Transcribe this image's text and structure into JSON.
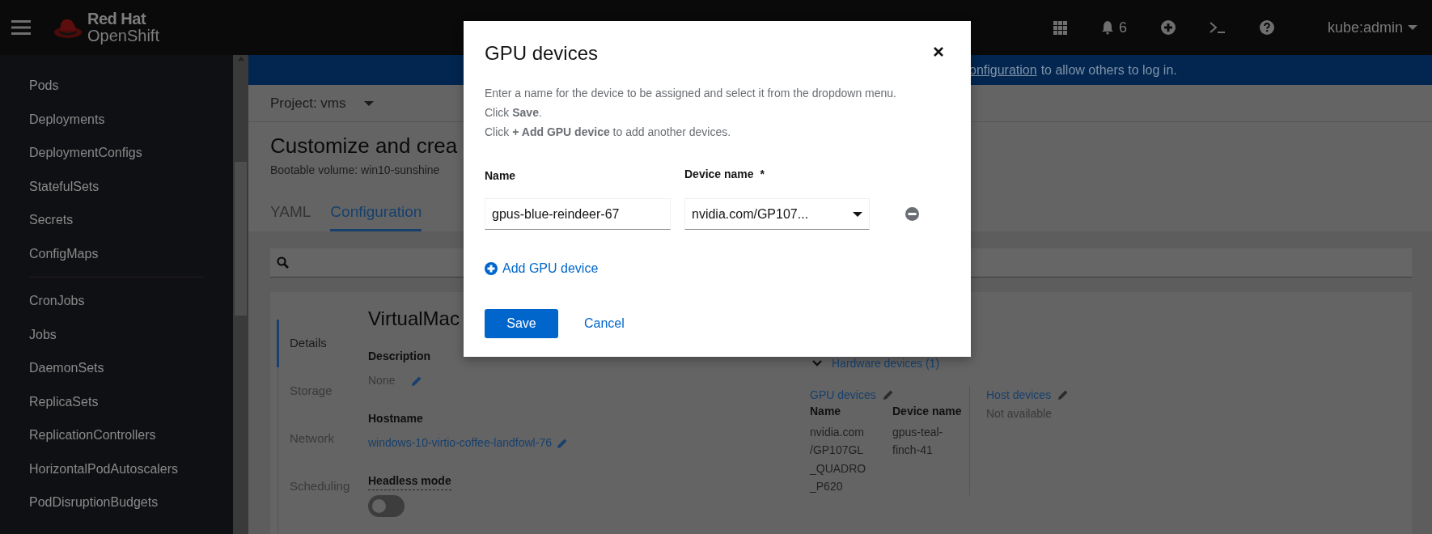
{
  "masthead": {
    "brand_top": "Red Hat",
    "brand_bottom": "OpenShift",
    "notification_count": "6",
    "user": "kube:admin"
  },
  "sidebar": {
    "groups": [
      {
        "items": [
          "Pods",
          "Deployments",
          "DeploymentConfigs",
          "StatefulSets",
          "Secrets",
          "ConfigMaps"
        ]
      },
      {
        "items": [
          "CronJobs",
          "Jobs",
          "DaemonSets",
          "ReplicaSets",
          "ReplicationControllers",
          "HorizontalPodAutoscalers",
          "PodDisruptionBudgets"
        ]
      }
    ]
  },
  "banner": {
    "link": "onfiguration",
    "text": "to allow others to log in."
  },
  "project_bar": {
    "label": "Project: vms"
  },
  "page": {
    "title": "Customize and crea",
    "subtitle": "Bootable volume: win10-sunshine",
    "tabs": [
      {
        "label": "YAML",
        "selected": false
      },
      {
        "label": "Configuration",
        "selected": true
      }
    ]
  },
  "config": {
    "nav": [
      {
        "label": "Details",
        "selected": true
      },
      {
        "label": "Storage",
        "selected": false
      },
      {
        "label": "Network",
        "selected": false
      },
      {
        "label": "Scheduling",
        "selected": false
      }
    ],
    "section_title": "VirtualMac",
    "fields": [
      {
        "kind": "text",
        "label": "Description",
        "value": "None",
        "editable": true
      },
      {
        "kind": "link",
        "label": "Hostname",
        "value": "windows-10-virtio-coffee-landfowl-76",
        "editable": true
      },
      {
        "kind": "toggle",
        "label": "Headless mode",
        "on": false
      }
    ],
    "hardware": {
      "label": "Hardware devices (1)",
      "expanded": true,
      "gpu": {
        "title": "GPU devices",
        "columns": [
          "Name",
          "Device name"
        ],
        "rows": [
          [
            "nvidia.com/GP107GL_QUADRO_P620",
            "gpus-teal-finch-41"
          ]
        ]
      },
      "host": {
        "title": "Host devices",
        "value": "Not available"
      }
    }
  },
  "dialog": {
    "title": "GPU devices",
    "lines": [
      "Enter a name for the device to be assigned and select it from the dropdown menu.",
      "Click **Save**.",
      "Click **+ Add GPU device** to add another devices."
    ],
    "name_label": "Name",
    "device_label": "Device name",
    "required_mark": "*",
    "devices": [
      {
        "name": "gpus-blue-reindeer-67",
        "device": "nvidia.com/GP107..."
      }
    ],
    "add_label": "Add GPU device",
    "save": "Save",
    "cancel": "Cancel"
  }
}
